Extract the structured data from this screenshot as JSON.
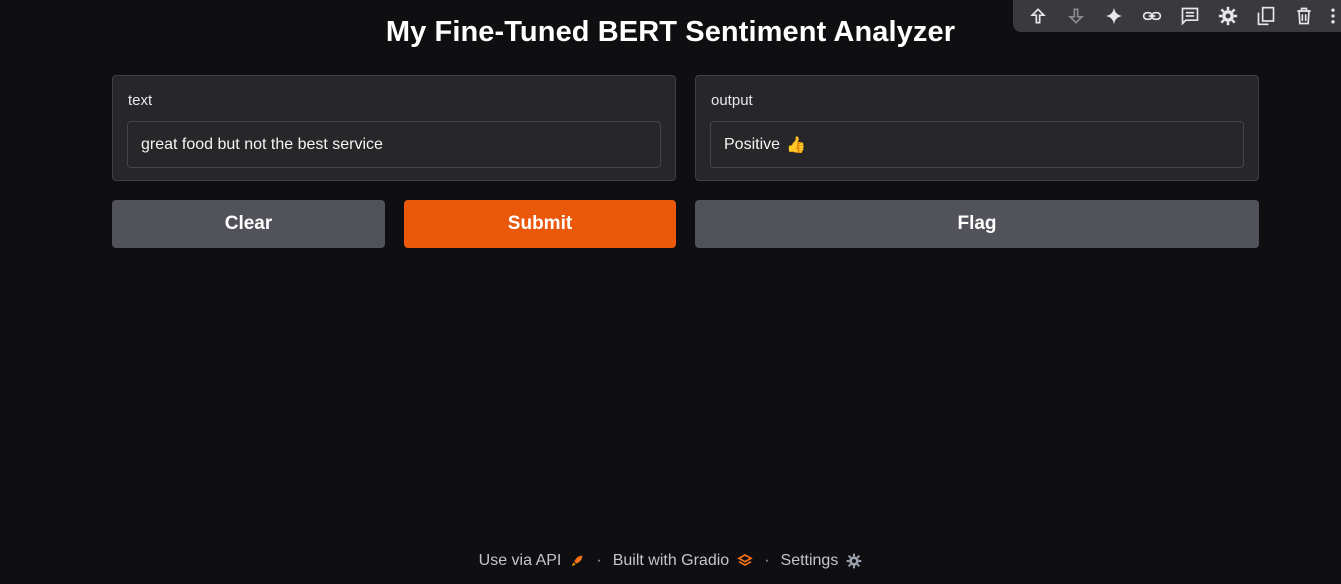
{
  "app": {
    "title": "My Fine-Tuned BERT Sentiment Analyzer"
  },
  "toolbar": {
    "icons": [
      "arrow-up-icon",
      "arrow-down-icon",
      "sparkle-icon",
      "link-icon",
      "comment-icon",
      "gear-icon",
      "mirror-cell-icon",
      "delete-icon",
      "more-vert-icon"
    ]
  },
  "input_panel": {
    "label": "text",
    "value": "great food but not the best service"
  },
  "output_panel": {
    "label": "output",
    "value": "Positive",
    "emoji": "👍"
  },
  "buttons": {
    "clear": "Clear",
    "submit": "Submit",
    "flag": "Flag"
  },
  "footer": {
    "api": "Use via API",
    "built": "Built with Gradio",
    "settings": "Settings",
    "separator": "·"
  },
  "colors": {
    "background": "#0f0f11",
    "panel": "#27272a",
    "primary": "#ea580c",
    "secondary": "#52525b"
  }
}
